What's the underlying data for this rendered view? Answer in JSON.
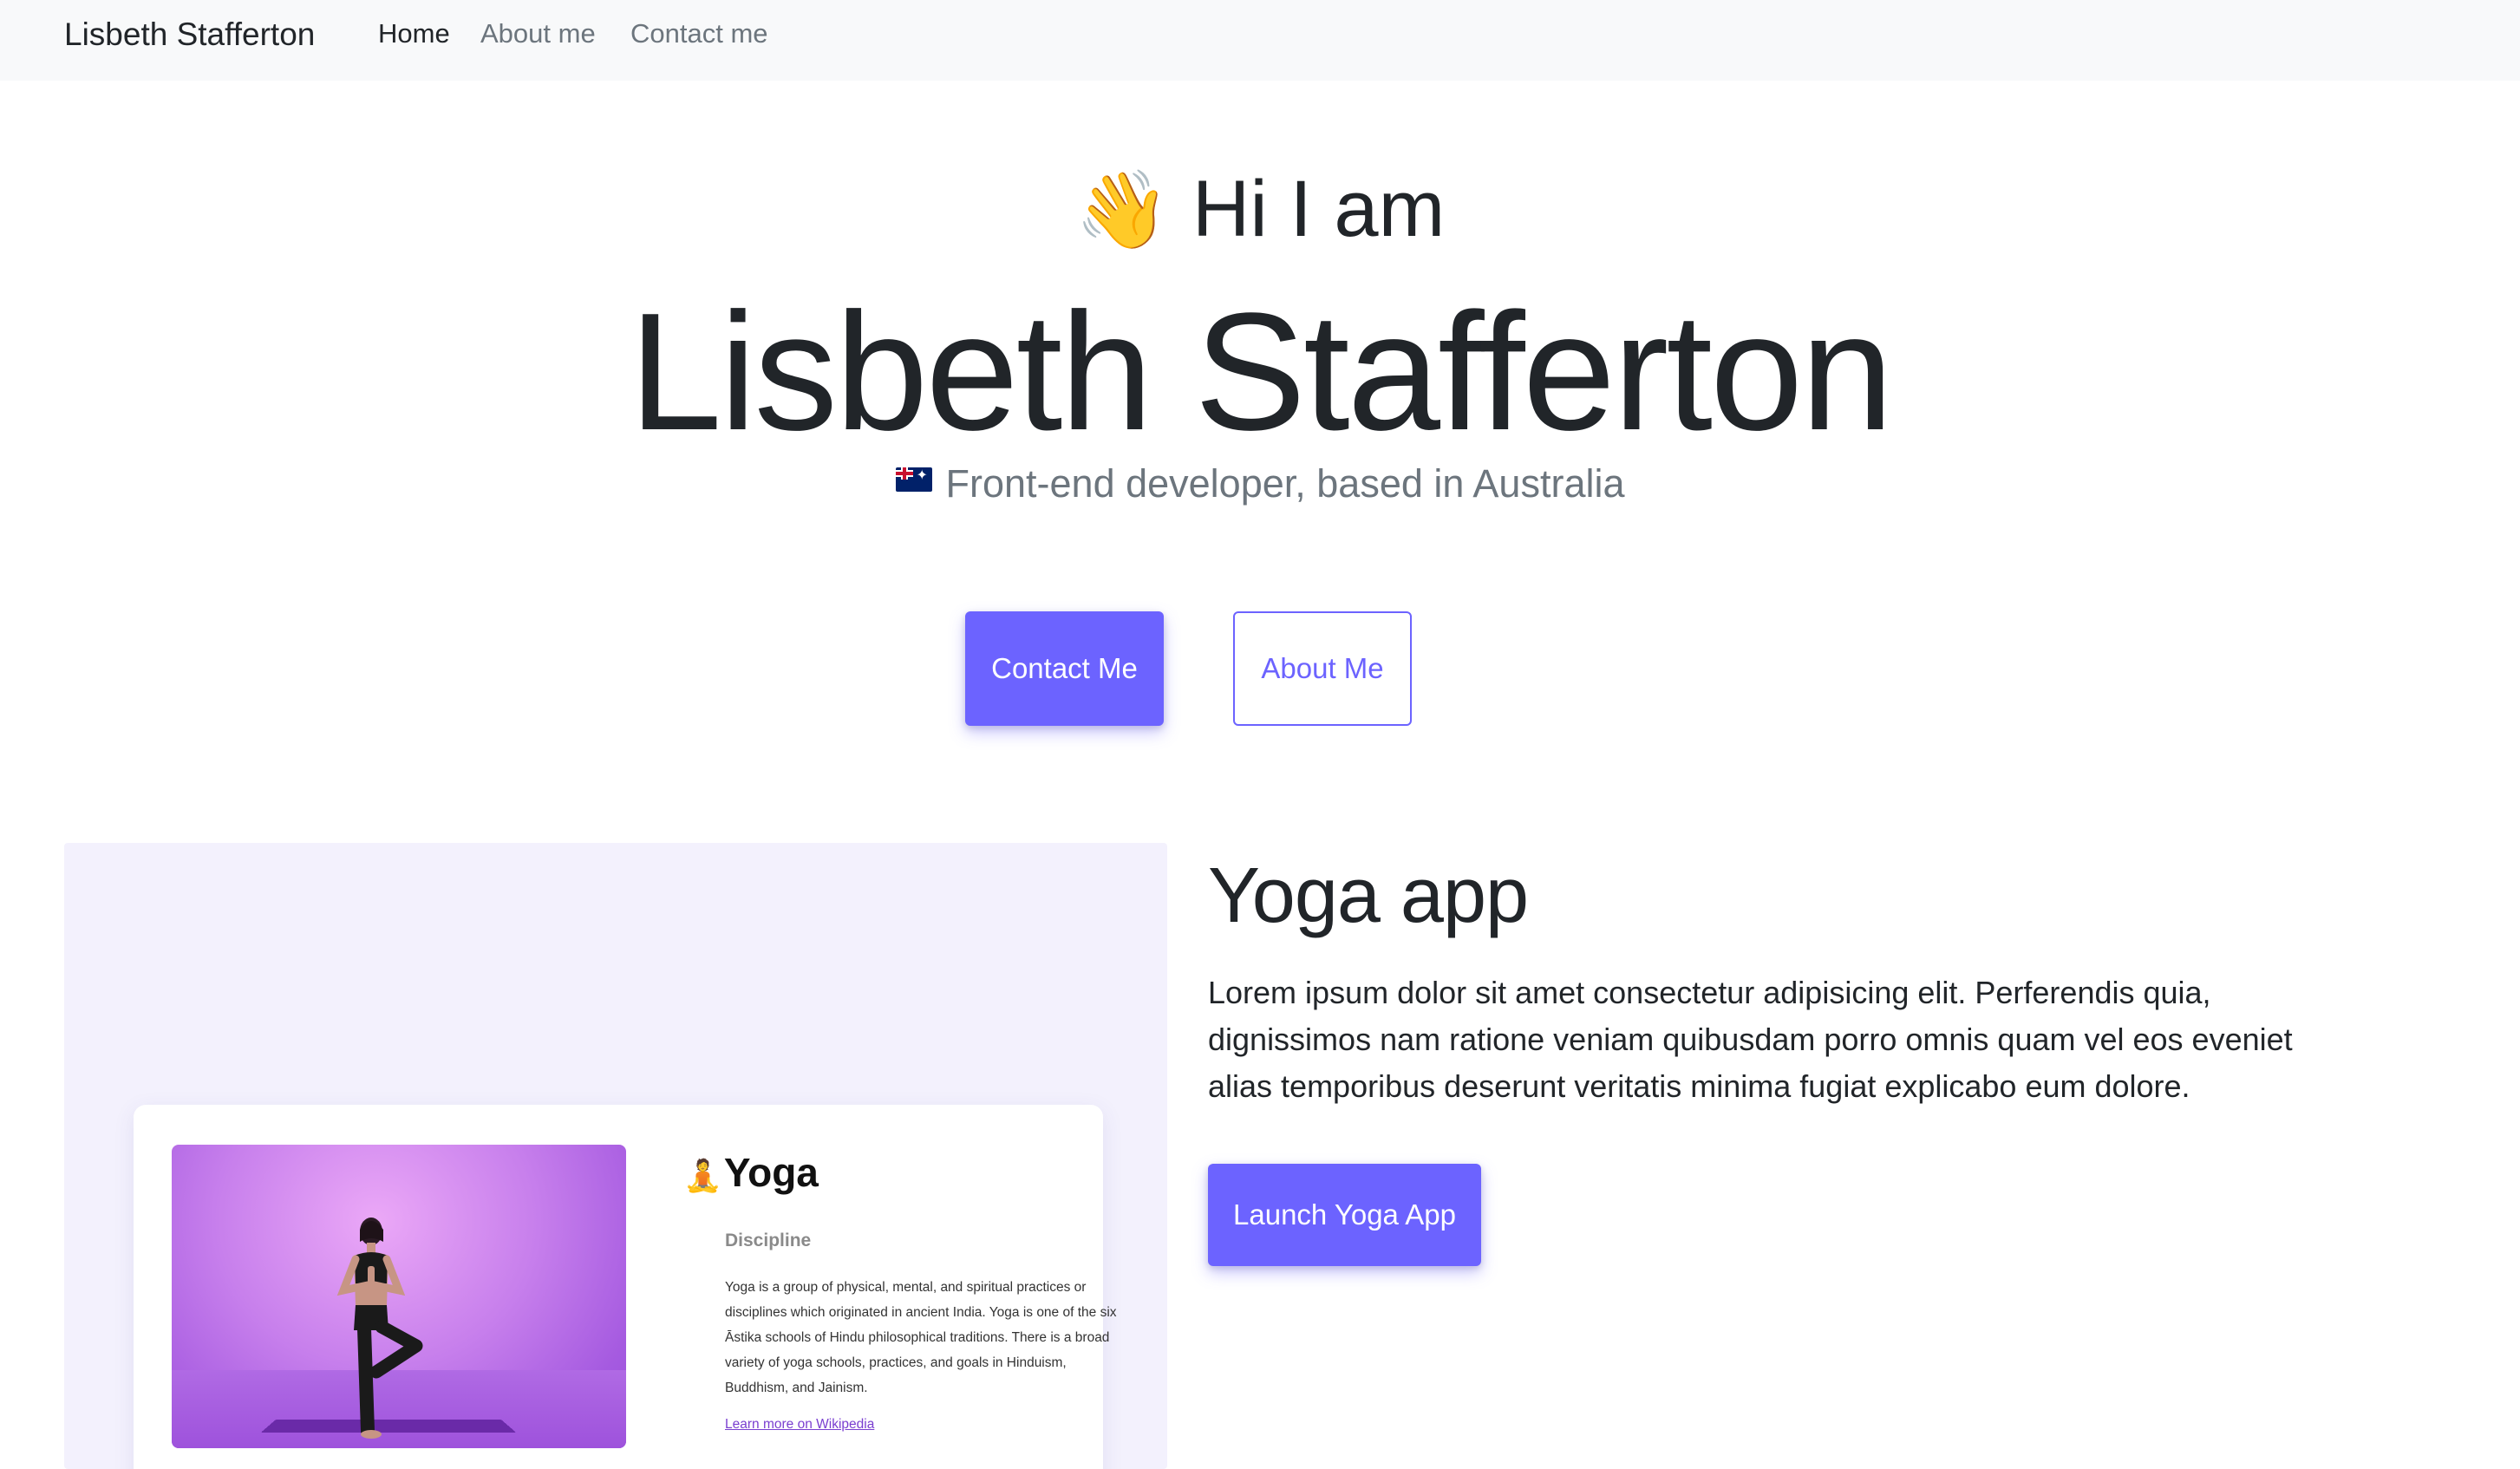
{
  "nav": {
    "brand": "Lisbeth Stafferton",
    "links": [
      {
        "label": "Home",
        "active": true
      },
      {
        "label": "About me",
        "active": false
      },
      {
        "label": "Contact me",
        "active": false
      }
    ]
  },
  "hero": {
    "greeting_emoji": "👋",
    "greeting": "Hi I am",
    "name": "Lisbeth Stafferton",
    "subtitle": "Front-end developer, based in Australia",
    "contact_button": "Contact Me",
    "about_button": "About Me"
  },
  "project": {
    "title": "Yoga app",
    "description": "Lorem ipsum dolor sit amet consectetur adipisicing elit. Perferendis quia, dignissimos nam ratione veniam quibusdam porro omnis quam vel eos eveniet alias temporibus deserunt veritatis minima fugiat explicabo eum dolore.",
    "launch_button": "Launch Yoga App",
    "preview": {
      "emoji": "🧘",
      "title": "Yoga",
      "label": "Discipline",
      "text": "Yoga is a group of physical, mental, and spiritual practices or disciplines which originated in ancient India. Yoga is one of the six Āstika schools of Hindu philosophical traditions. There is a broad variety of yoga schools, practices, and goals in Hinduism, Buddhism, and Jainism.",
      "link": "Learn more on Wikipedia"
    }
  },
  "colors": {
    "accent": "#6c63ff",
    "navbar_bg": "#f8f9fa",
    "panel_bg": "#f3f1fd",
    "muted_text": "#6c757d"
  }
}
